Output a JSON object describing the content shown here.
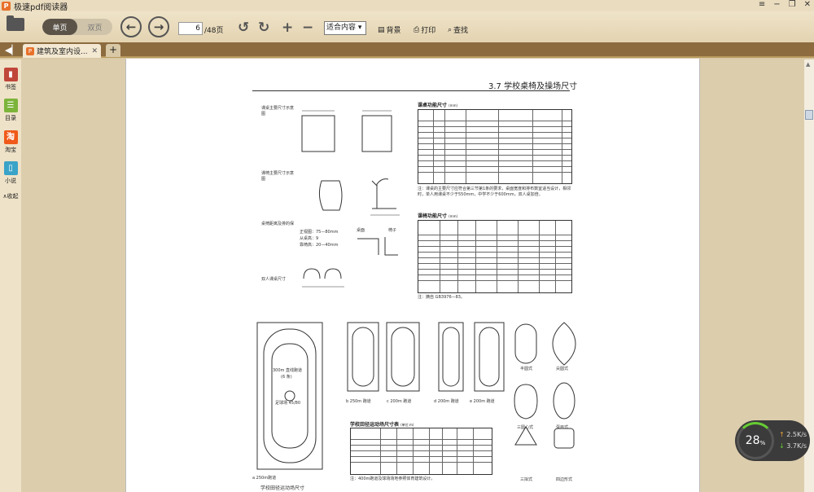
{
  "window": {
    "app_title": "极速pdf阅读器"
  },
  "toolbar": {
    "single_page": "单页",
    "double_page": "双页",
    "current_page": "6",
    "total_pages": "/48页",
    "fit_mode": "适合内容",
    "background": "背景",
    "print": "打印",
    "search": "查找"
  },
  "tab": {
    "title": "建筑及室内设..."
  },
  "sidebar": {
    "items": [
      "书签",
      "目录",
      "淘宝",
      "小说"
    ],
    "collapse": "∧收起"
  },
  "document": {
    "header": "3.7 学校桌椅及操场尺寸",
    "desk_table_title": "课桌功能尺寸",
    "desk_table_unit": "(mm)",
    "chair_table_title": "课椅功能尺寸",
    "chair_table_unit": "(mm)",
    "track_table_title": "学校田径运动场尺寸表",
    "track_table_unit": "(单位:m)",
    "track_caption": "学校田径运动场尺寸",
    "label_desk_front": "课桌主要尺寸示意图",
    "label_chair": "课椅主要尺寸示意图",
    "label_distance": "桌椅距离及排的保",
    "label_double": "双人课桌尺寸",
    "label_chair_note": "注：摘自 GB3976—83。",
    "label_desk_note": "注：课桌的主要尺寸应符合第三节第1条的要求，桌面宽度和排布数宜适当设计，相邻时，单人用课桌不少于550mm，中学不少于600mm，双人桌加倍。",
    "label_running_a": "a 250m跑道",
    "label_running_b": "b 250m 跑道",
    "label_running_c": "c 200m 跑道",
    "label_running_d": "d 200m 跑道",
    "label_running_e": "e 200m 跑道",
    "label_track_300": "300m 直线跑道",
    "label_lanes": "(6 条)",
    "label_football": "足球场 45/80",
    "label_track_note": "注：400m跑道及球场场地参照体育建筑设计。",
    "shape_labels": [
      "半圆式",
      "尖圆式",
      "三圆心式",
      "蛋目式",
      "三拟式",
      "四边形式"
    ],
    "dim_labels": [
      "正视图：75—80mm",
      "从桌高：9",
      "靠椅高：20—40mm",
      "桌面",
      "椅子"
    ]
  },
  "speed": {
    "percent": "28",
    "unit": "%",
    "up": "2.5K/s",
    "down": "3.7K/s"
  },
  "colors": {
    "toolbar_bg": "#e3d3b1",
    "tabbar_bg": "#8c6b3f",
    "accent": "#e8712b"
  }
}
